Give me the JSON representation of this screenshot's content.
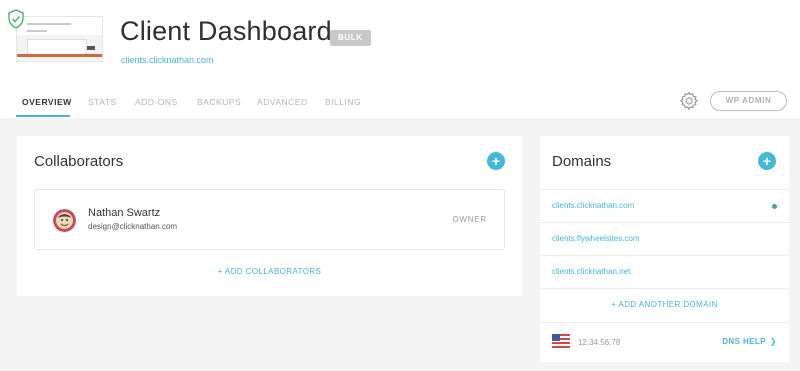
{
  "header": {
    "title": "Client Dashboard",
    "badge": "BULK",
    "subdomain": "clients.clicknathan.com",
    "wp_admin_label": "WP ADMIN"
  },
  "tabs": [
    {
      "label": "OVERVIEW",
      "active": true
    },
    {
      "label": "STATS",
      "active": false
    },
    {
      "label": "ADD-ONS",
      "active": false
    },
    {
      "label": "BACKUPS",
      "active": false
    },
    {
      "label": "ADVANCED",
      "active": false
    },
    {
      "label": "BILLING",
      "active": false
    }
  ],
  "collaborators": {
    "title": "Collaborators",
    "add_icon": "plus-icon",
    "people": [
      {
        "name": "Nathan Swartz",
        "email": "design@clicknathan.com",
        "role": "OWNER"
      }
    ],
    "add_label": "+ ADD COLLABORATORS"
  },
  "domains": {
    "title": "Domains",
    "add_icon": "plus-icon",
    "items": [
      {
        "name": "clients.clicknathan.com",
        "status": "active"
      },
      {
        "name": "clients.flywheelsites.com",
        "status": ""
      },
      {
        "name": "clients.clicknathan.net",
        "status": ""
      }
    ],
    "add_label": "+ ADD ANOTHER DOMAIN",
    "ip": "12.34.56.78",
    "flag_icon": "us-flag-icon",
    "dns_help_label": "DNS HELP",
    "dns_help_icon": "chevron-right-icon"
  },
  "colors": {
    "accent": "#45b8d8",
    "active_dot": "#3fae7a",
    "badge_bg": "#c8c8c8"
  }
}
